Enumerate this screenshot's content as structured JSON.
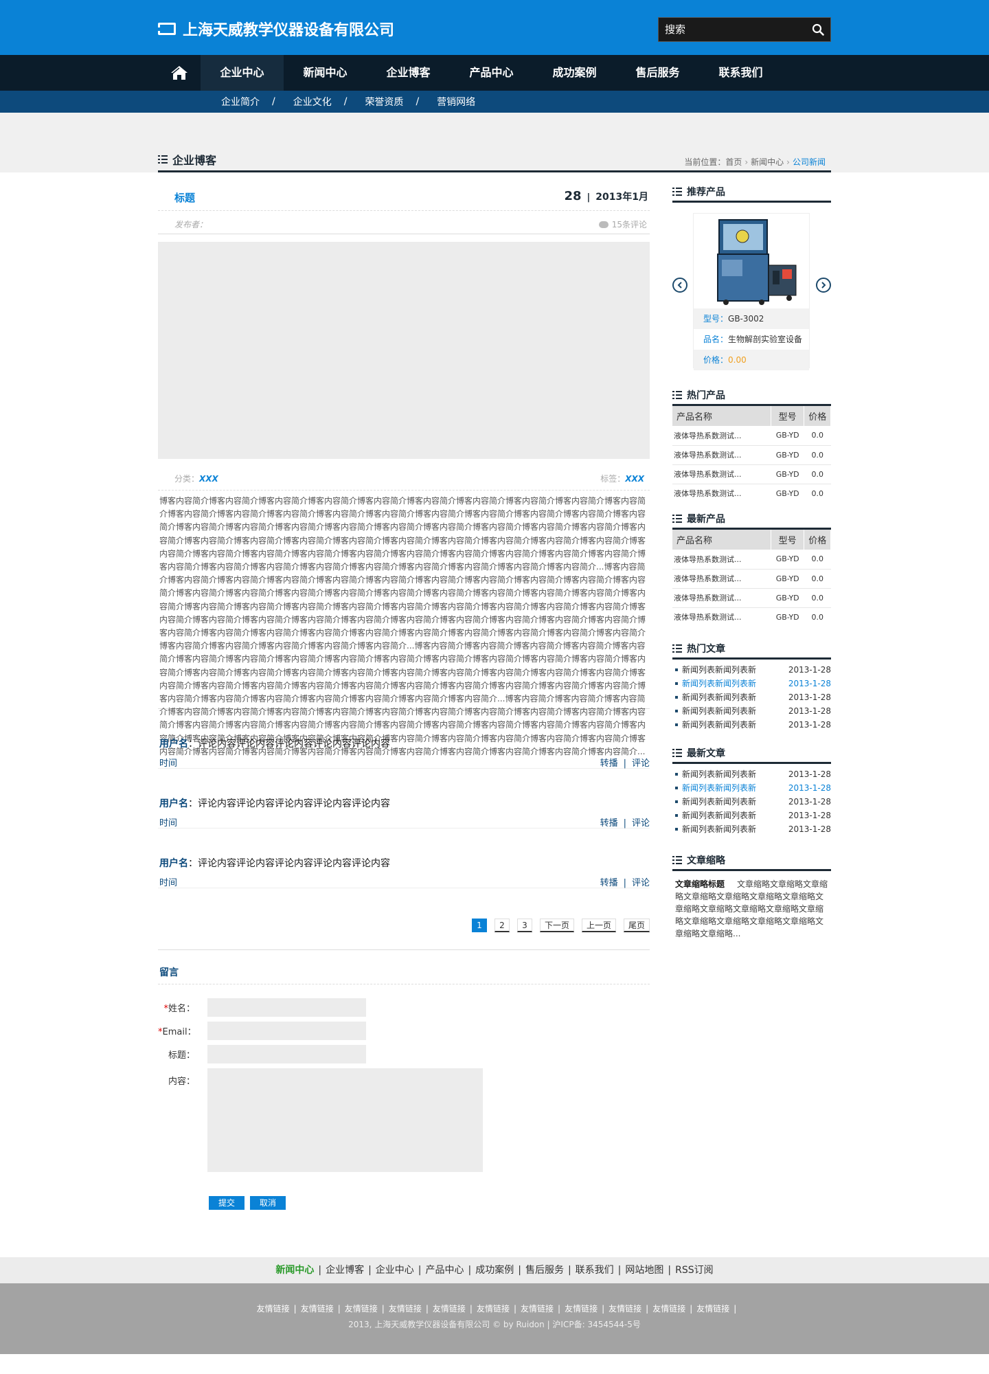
{
  "header": {
    "company": "上海天威教学仪器设备有限公司",
    "search_placeholder": "搜索"
  },
  "nav": {
    "items": [
      "企业中心",
      "新闻中心",
      "企业博客",
      "产品中心",
      "成功案例",
      "售后服务",
      "联系我们"
    ],
    "active": 0
  },
  "subnav": [
    "企业简介",
    "企业文化",
    "荣誉资质",
    "营销网络"
  ],
  "section": {
    "title": "企业博客",
    "crumb_prefix": "当前位置：",
    "crumbs": [
      "首页",
      "新闻中心"
    ],
    "crumb_current": "公司新闻"
  },
  "post": {
    "title": "标题",
    "day": "28",
    "month": "2013年1月",
    "author_label": "发布者：",
    "comments": "15条评论",
    "category_label": "分类：",
    "category": "XXX",
    "tag_label": "标签：",
    "tag": "XXX",
    "body": "博客内容简介博客内容简介博客内容简介博客内容简介博客内容简介博客内容简介博客内容简介博客内容简介博客内容简介博客内容简介博客内容简介博客内容简介博客内容简介博客内容简介博客内容简介博客内容简介博客内容简介博客内容简介博客内容简介博客内容简介博客内容简介博客内容简介博客内容简介博客内容简介博客内容简介博客内容简介博客内容简介博客内容简介博客内容简介博客内容简介博客内容简介博客内容简介博客内容简介博客内容简介博客内容简介博客内容简介博客内容简介博客内容简介博客内容简介博客内容简介博客内容简介博客内容简介博客内容简介博客内容简介博客内容简介博客内容简介博客内容简介博客内容简介博客内容简介博客内容简介博客内容简介博客内容简介博客内容简介博客内容简介博客内容简介博客内容简介博客内容简介博客内容简介...博客内容简介博客内容简介博客内容简介博客内容简介博客内容简介博客内容简介博客内容简介博客内容简介博客内容简介博客内容简介博客内容简介博客内容简介博客内容简介博客内容简介博客内容简介博客内容简介博客内容简介博客内容简介博客内容简介博客内容简介博客内容简介博客内容简介博客内容简介博客内容简介博客内容简介博客内容简介博客内容简介博客内容简介博客内容简介博客内容简介博客内容简介博客内容简介博客内容简介博客内容简介博客内容简介博客内容简介博客内容简介博客内容简介博客内容简介博客内容简介博客内容简介博客内容简介博客内容简介博客内容简介博客内容简介博客内容简介博客内容简介博客内容简介博客内容简介博客内容简介博客内容简介博客内容简介博客内容简介博客内容简介博客内容简介...博客内容简介博客内容简介博客内容简介博客内容简介博客内容简介博客内容简介博客内容简介博客内容简介博客内容简介博客内容简介博客内容简介博客内容简介博客内容简介博客内容简介博客内容简介博客内容简介博客内容简介博客内容简介博客内容简介博客内容简介博客内容简介博客内容简介博客内容简介博客内容简介博客内容简介博客内容简介博客内容简介博客内容简介博客内容简介博客内容简介博客内容简介博客内容简介博客内容简介博客内容简介博客内容简介博客内容简介博客内容简介博客内容简介博客内容简介博客内容简介博客内容简介...博客内容简介博客内容简介博客内容简介博客内容简介博客内容简介博客内容简介博客内容简介博客内容简介博客内容简介博客内容简介博客内容简介博客内容简介博客内容简介博客内容简介博客内容简介博客内容简介博客内容简介博客内容简介博客内容简介博客内容简介博客内容简介博客内容简介博客内容简介博客内容简介博客内容简介博客内容简介博客内容简介博客内容简介博客内容简介博客内容简介博客内容简介博客内容简介博客内容简介博客内容简介博客内容简介博客内容简介博客内容简介博客内容简介博客内容简介博客内容简介博客内容简介博客内容简介..."
  },
  "comments": [
    {
      "user": "用户名",
      "text": "：评论内容评论内容评论内容评论内容评论内容",
      "time": "时间",
      "repost": "转播",
      "reply": "评论"
    },
    {
      "user": "用户名",
      "text": "：评论内容评论内容评论内容评论内容评论内容",
      "time": "时间",
      "repost": "转播",
      "reply": "评论"
    },
    {
      "user": "用户名",
      "text": "：评论内容评论内容评论内容评论内容评论内容",
      "time": "时间",
      "repost": "转播",
      "reply": "评论"
    }
  ],
  "pager": {
    "pages": [
      "1",
      "2",
      "3"
    ],
    "current": "1",
    "next": "下一页",
    "prev": "上一页",
    "last": "尾页"
  },
  "form": {
    "title": "留言",
    "name": "姓名：",
    "email": "Email：",
    "subject": "标题：",
    "content": "内容：",
    "required_mark": "*",
    "submit": "提交",
    "cancel": "取消"
  },
  "sidebar": {
    "recommended": {
      "title": "推荐产品",
      "model_label": "型号：",
      "model": "GB-3002",
      "name_label": "品名：",
      "name": "生物解剖实验室设备",
      "price_label": "价格：",
      "price": "0.00"
    },
    "hot_products": {
      "title": "热门产品",
      "headers": [
        "产品名称",
        "型号",
        "价格"
      ],
      "rows": [
        [
          "液体导热系数测试...",
          "GB-YD",
          "0.0"
        ],
        [
          "液体导热系数测试...",
          "GB-YD",
          "0.0"
        ],
        [
          "液体导热系数测试...",
          "GB-YD",
          "0.0"
        ],
        [
          "液体导热系数测试...",
          "GB-YD",
          "0.0"
        ]
      ]
    },
    "new_products": {
      "title": "最新产品",
      "headers": [
        "产品名称",
        "型号",
        "价格"
      ],
      "rows": [
        [
          "液体导热系数测试...",
          "GB-YD",
          "0.0"
        ],
        [
          "液体导热系数测试...",
          "GB-YD",
          "0.0"
        ],
        [
          "液体导热系数测试...",
          "GB-YD",
          "0.0"
        ],
        [
          "液体导热系数测试...",
          "GB-YD",
          "0.0"
        ]
      ]
    },
    "hot_articles": {
      "title": "热门文章",
      "items": [
        {
          "t": "新闻列表新闻列表新",
          "d": "2013-1-28"
        },
        {
          "t": "新闻列表新闻列表新",
          "d": "2013-1-28"
        },
        {
          "t": "新闻列表新闻列表新",
          "d": "2013-1-28"
        },
        {
          "t": "新闻列表新闻列表新",
          "d": "2013-1-28"
        },
        {
          "t": "新闻列表新闻列表新",
          "d": "2013-1-28"
        }
      ],
      "highlight": 1
    },
    "new_articles": {
      "title": "最新文章",
      "items": [
        {
          "t": "新闻列表新闻列表新",
          "d": "2013-1-28"
        },
        {
          "t": "新闻列表新闻列表新",
          "d": "2013-1-28"
        },
        {
          "t": "新闻列表新闻列表新",
          "d": "2013-1-28"
        },
        {
          "t": "新闻列表新闻列表新",
          "d": "2013-1-28"
        },
        {
          "t": "新闻列表新闻列表新",
          "d": "2013-1-28"
        }
      ],
      "highlight": 1
    },
    "abstract": {
      "title": "文章缩略",
      "head": "文章缩略标题",
      "text": "文章缩略文章缩略文章缩略文章缩略文章缩略文章缩略文章缩略文章缩略文章缩略文章缩略文章缩略文章缩略文章缩略文章缩略文章缩略文章缩略文章缩略文章缩略..."
    }
  },
  "footer": {
    "links": [
      "新闻中心",
      "企业博客",
      "企业中心",
      "产品中心",
      "成功案例",
      "售后服务",
      "联系我们",
      "网站地图",
      "RSS订阅"
    ],
    "friend_links": [
      "友情链接",
      "友情链接",
      "友情链接",
      "友情链接",
      "友情链接",
      "友情链接",
      "友情链接",
      "友情链接",
      "友情链接",
      "友情链接",
      "友情链接"
    ],
    "copyright": "2013, 上海天威教学仪器设备有限公司 © by Ruidon | 沪ICP备: 3454544-5号"
  },
  "colors": {
    "brand_blue": "#0a82d6",
    "nav_dark": "#0b1c2a",
    "subnav": "#0d4a7c"
  }
}
